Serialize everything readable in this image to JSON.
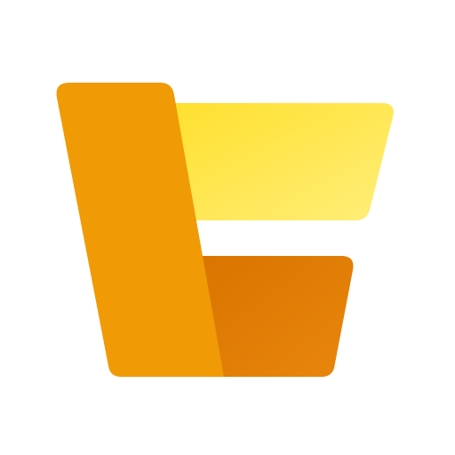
{
  "logo": {
    "icon": "stacked-folders-logo",
    "colors": {
      "left_panel": "#F09A06",
      "left_panel_edge": "#F4A91A",
      "top_panel_light": "#FFEE7A",
      "top_panel_main": "#FFE02E",
      "bottom_panel_light": "#E9860C",
      "bottom_panel_dark": "#D97500",
      "background": "#FFFFFF"
    }
  }
}
